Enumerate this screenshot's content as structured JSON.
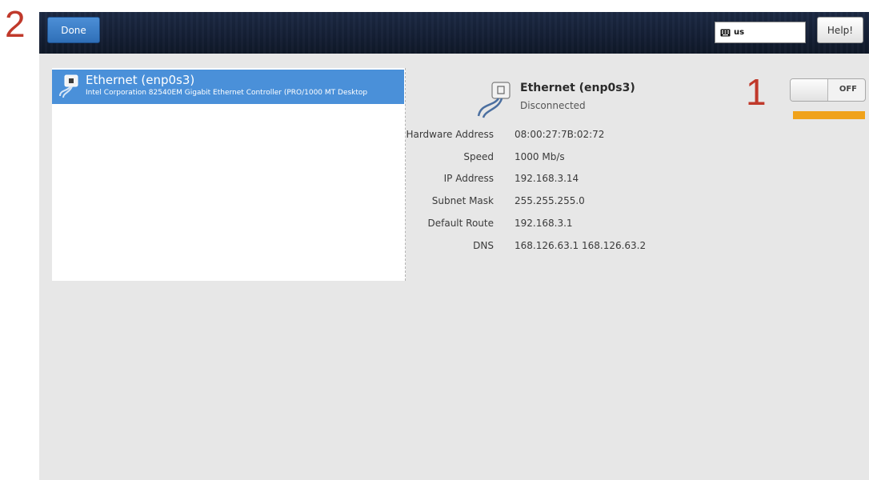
{
  "annotations": {
    "step_1": "1",
    "step_2": "2"
  },
  "header": {
    "done_label": "Done",
    "keyboard_layout": "us",
    "help_label": "Help!"
  },
  "device_list": {
    "items": [
      {
        "name": "Ethernet (enp0s3)",
        "description": "Intel Corporation 82540EM Gigabit Ethernet Controller (PRO/1000 MT Desktop",
        "selected": true,
        "icon": "ethernet-icon"
      }
    ]
  },
  "detail": {
    "name": "Ethernet (enp0s3)",
    "status": "Disconnected",
    "icon": "ethernet-icon",
    "switch_state": "OFF",
    "properties": [
      {
        "label": "Hardware Address",
        "value": "08:00:27:7B:02:72"
      },
      {
        "label": "Speed",
        "value": "1000 Mb/s"
      },
      {
        "label": "IP Address",
        "value": "192.168.3.14"
      },
      {
        "label": "Subnet Mask",
        "value": "255.255.255.0"
      },
      {
        "label": "Default Route",
        "value": "192.168.3.1"
      },
      {
        "label": "DNS",
        "value": "168.126.63.1 168.126.63.2"
      }
    ]
  },
  "colors": {
    "accent": "#4a90d9",
    "header_bg": "#152036",
    "highlight": "#f0a21b",
    "annotation": "#c0392b",
    "content_bg": "#e7e7e7"
  }
}
